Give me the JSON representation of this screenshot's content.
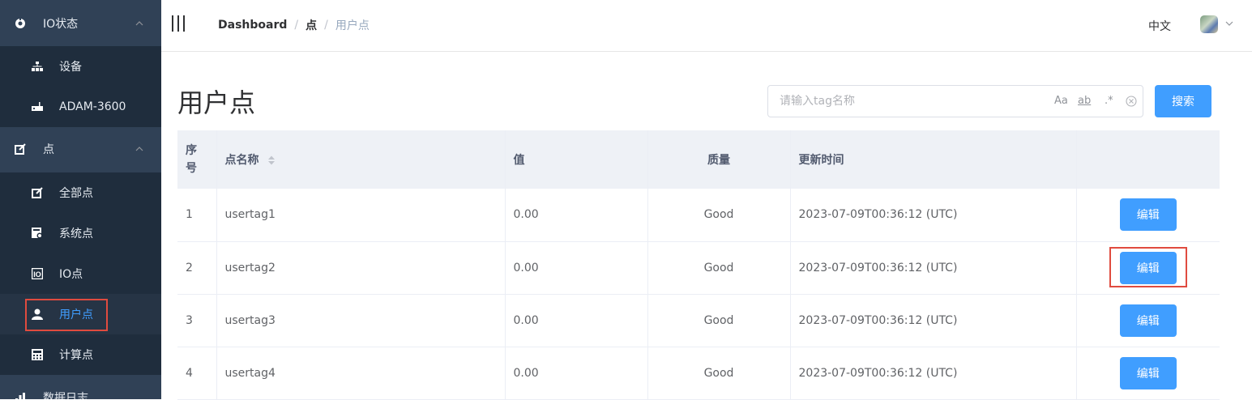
{
  "sidebar": {
    "io_status": "IO状态",
    "devices": "设备",
    "adam": "ADAM-3600",
    "points": "点",
    "all_points": "全部点",
    "system_points": "系统点",
    "io_points": "IO点",
    "user_points": "用户点",
    "calc_points": "计算点",
    "data_log": "数据日志"
  },
  "header": {
    "breadcrumb": [
      "Dashboard",
      "点",
      "用户点"
    ],
    "language": "中文"
  },
  "main": {
    "title": "用户点",
    "search_placeholder": "请输入tag名称",
    "search_opts": [
      "Aa",
      "ab",
      ".*"
    ],
    "search_button": "搜索",
    "columns": [
      "序号",
      "点名称",
      "值",
      "质量",
      "更新时间",
      ""
    ],
    "edit_label": "编辑",
    "rows": [
      {
        "index": "1",
        "name": "usertag1",
        "value": "0.00",
        "quality": "Good",
        "time": "2023-07-09T00:36:12 (UTC)"
      },
      {
        "index": "2",
        "name": "usertag2",
        "value": "0.00",
        "quality": "Good",
        "time": "2023-07-09T00:36:12 (UTC)"
      },
      {
        "index": "3",
        "name": "usertag3",
        "value": "0.00",
        "quality": "Good",
        "time": "2023-07-09T00:36:12 (UTC)"
      },
      {
        "index": "4",
        "name": "usertag4",
        "value": "0.00",
        "quality": "Good",
        "time": "2023-07-09T00:36:12 (UTC)"
      }
    ]
  },
  "colors": {
    "accent": "#409eff",
    "sidebar_bg": "#304156",
    "highlight": "#e04b3f"
  }
}
